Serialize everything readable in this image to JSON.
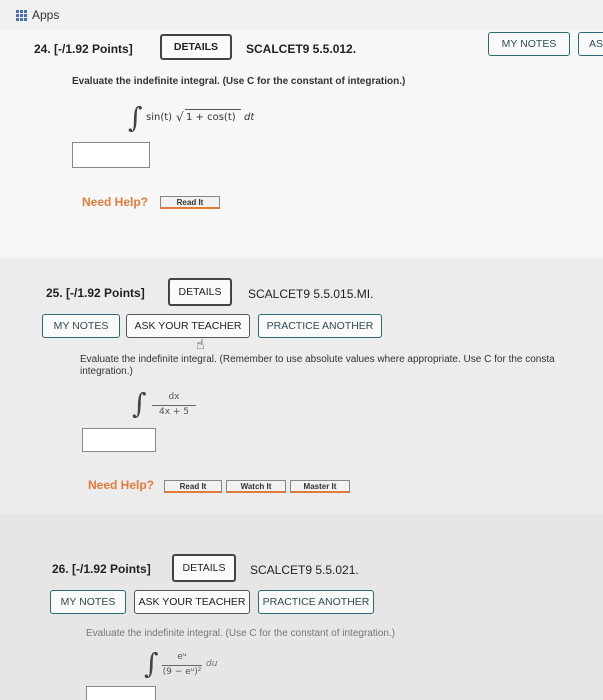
{
  "topbar": {
    "apps_label": "Apps"
  },
  "q24": {
    "title": "24.  [-/1.92 Points]",
    "details_label": "DETAILS",
    "code": "SCALCET9 5.5.012.",
    "my_notes_label": "MY NOTES",
    "ask_label": "AS",
    "instruction": "Evaluate the indefinite integral. (Use C for the constant of integration.)",
    "integral_symbol": "∫",
    "integrand": "sin(t)",
    "radical": "√",
    "radicand": "1 + cos(t)",
    "differential": "dt",
    "need_help": "Need Help?",
    "read_it": "Read It"
  },
  "q25": {
    "title": "25.  [-/1.92 Points]",
    "details_label": "DETAILS",
    "code": "SCALCET9 5.5.015.MI.",
    "my_notes_label": "MY NOTES",
    "ask_label": "ASK YOUR TEACHER",
    "practice_label": "PRACTICE ANOTHER",
    "instruction_line1": "Evaluate the indefinite integral. (Remember to use absolute values where appropriate. Use C for the consta",
    "instruction_line2": "integration.)",
    "integral_symbol": "∫",
    "numerator": "dx",
    "denominator": "4x + 5",
    "need_help": "Need Help?",
    "read_it": "Read It",
    "watch_it": "Watch It",
    "master_it": "Master It"
  },
  "q26": {
    "title": "26.  [-/1.92 Points]",
    "details_label": "DETAILS",
    "code": "SCALCET9 5.5.021.",
    "my_notes_label": "MY NOTES",
    "ask_label": "ASK YOUR TEACHER",
    "practice_label": "PRACTICE ANOTHER",
    "instruction": "Evaluate the indefinite integral. (Use C for the constant of integration.)",
    "integral_symbol": "∫",
    "numerator": "eᵘ",
    "denominator": "(9 − eᵘ)²",
    "differential": "du"
  }
}
